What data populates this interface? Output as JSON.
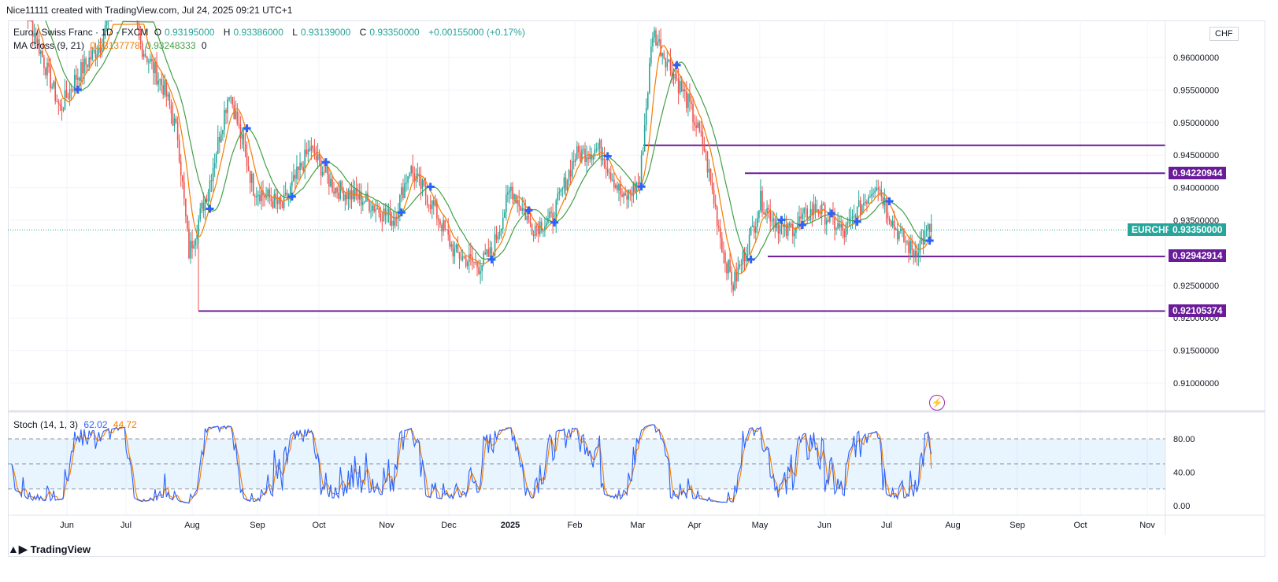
{
  "header": {
    "attribution": "Nice11111 created with TradingView.com, Jul 24, 2025 09:21 UTC+1"
  },
  "legend": {
    "symbol": "Euro / Swiss Franc · 1D · FXCM",
    "open_label": "O",
    "open": "0.93195000",
    "high_label": "H",
    "high": "0.93386000",
    "low_label": "L",
    "low": "0.93139000",
    "close_label": "C",
    "close": "0.93350000",
    "change": "+0.00155000 (+0.17%)",
    "ma_name": "MA Cross (9, 21)",
    "ma_fast": "0.93137778",
    "ma_slow": "0.93248333",
    "ma_extra": "0",
    "stoch_name": "Stoch (14, 1, 3)",
    "stoch_k": "62.02",
    "stoch_d": "44.72"
  },
  "axis": {
    "currency": "CHF",
    "price_ticks": [
      "0.96000000",
      "0.95500000",
      "0.95000000",
      "0.94500000",
      "0.94000000",
      "0.93500000",
      "0.92500000",
      "0.92000000",
      "0.91500000",
      "0.91000000"
    ],
    "stoch_ticks": [
      "80.00",
      "40.00",
      "0.00"
    ],
    "time_labels": [
      "Jun",
      "Jul",
      "Aug",
      "Sep",
      "Oct",
      "Nov",
      "Dec",
      "2025",
      "Feb",
      "Mar",
      "Apr",
      "May",
      "Jun",
      "Jul",
      "Aug",
      "Sep",
      "Oct",
      "Nov"
    ]
  },
  "tags": {
    "level_top": "0.94220944",
    "symbol_tag": "EURCHF",
    "current": "0.93350000",
    "level_mid": "0.92942914",
    "level_bottom": "0.92105374"
  },
  "colors": {
    "up": "#26a69a",
    "down": "#ef5350",
    "ma_fast": "#f57c00",
    "ma_slow": "#43a047",
    "level": "#6a1b9a",
    "stoch_k": "#2962ff",
    "stoch_d": "#f57c00",
    "cross": "#2962ff"
  },
  "footer": {
    "brand": "TradingView"
  },
  "chart_data": [
    {
      "type": "candlestick",
      "title": "Euro / Swiss Franc · 1D · FXCM",
      "ylim": [
        0.9055,
        0.9655
      ],
      "levels": [
        0.9465,
        0.94220944,
        0.92942914,
        0.92105374
      ],
      "current_price": 0.9335,
      "path_anchors": [
        [
          0,
          0.974
        ],
        [
          30,
          0.952
        ],
        [
          40,
          0.957
        ],
        [
          55,
          0.962
        ],
        [
          70,
          0.974
        ],
        [
          80,
          0.962
        ],
        [
          95,
          0.955
        ],
        [
          103,
          0.948
        ],
        [
          110,
          0.93
        ],
        [
          122,
          0.94
        ],
        [
          135,
          0.955
        ],
        [
          150,
          0.94
        ],
        [
          168,
          0.937
        ],
        [
          185,
          0.946
        ],
        [
          200,
          0.94
        ],
        [
          220,
          0.938
        ],
        [
          237,
          0.935
        ],
        [
          247,
          0.943
        ],
        [
          262,
          0.937
        ],
        [
          275,
          0.93
        ],
        [
          290,
          0.928
        ],
        [
          298,
          0.93
        ],
        [
          310,
          0.94
        ],
        [
          323,
          0.934
        ],
        [
          335,
          0.935
        ],
        [
          350,
          0.945
        ],
        [
          365,
          0.946
        ],
        [
          380,
          0.938
        ],
        [
          390,
          0.941
        ],
        [
          398,
          0.964
        ],
        [
          410,
          0.958
        ],
        [
          420,
          0.953
        ],
        [
          430,
          0.946
        ],
        [
          442,
          0.93
        ],
        [
          448,
          0.925
        ],
        [
          458,
          0.932
        ],
        [
          465,
          0.938
        ],
        [
          480,
          0.933
        ],
        [
          500,
          0.937
        ],
        [
          517,
          0.933
        ],
        [
          537,
          0.941
        ],
        [
          548,
          0.934
        ],
        [
          560,
          0.93
        ],
        [
          571,
          0.934
        ]
      ]
    },
    {
      "type": "line",
      "title": "Stoch (14, 1, 3)",
      "ylim": [
        0,
        100
      ],
      "bands": [
        80,
        50,
        20
      ],
      "series": [
        {
          "name": "%K",
          "last": 62.02
        },
        {
          "name": "%D",
          "last": 44.72
        }
      ]
    }
  ]
}
